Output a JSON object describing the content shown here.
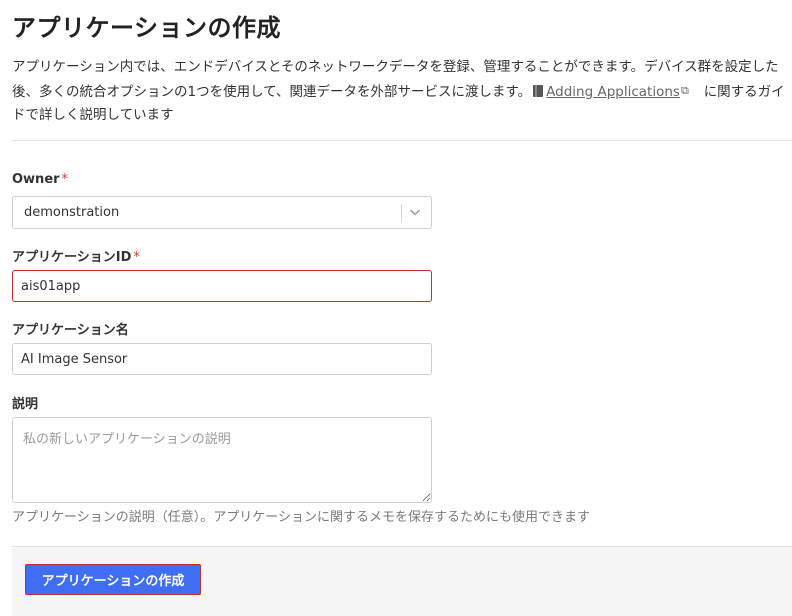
{
  "page": {
    "title": "アプリケーションの作成"
  },
  "intro": {
    "text_before": "アプリケーション内では、エンドデバイスとそのネットワークデータを登録、管理することができます。デバイス群を設定した後、多くの統合オプションの1つを使用して、関連データを外部サービスに渡します。",
    "link_label": "Adding Applications",
    "text_after": "に関するガイドで詳しく説明しています",
    "doc_icon": "document-icon",
    "link_icon": "external-link-icon"
  },
  "form": {
    "owner": {
      "label": "Owner",
      "required_mark": "*",
      "value": "demonstration"
    },
    "application_id": {
      "label": "アプリケーションID",
      "required_mark": "*",
      "value": "ais01app",
      "state": "error"
    },
    "application_name": {
      "label": "アプリケーション名",
      "value": "AI Image Sensor"
    },
    "description": {
      "label": "説明",
      "placeholder": "私の新しいアプリケーションの説明",
      "value": "",
      "hint": "アプリケーションの説明（任意）。アプリケーションに関するメモを保存するためにも使用できます"
    }
  },
  "actions": {
    "submit_label": "アプリケーションの作成"
  },
  "colors": {
    "accent": "#3f6ef2",
    "error": "#c62f2f",
    "required": "#d03a3a"
  }
}
